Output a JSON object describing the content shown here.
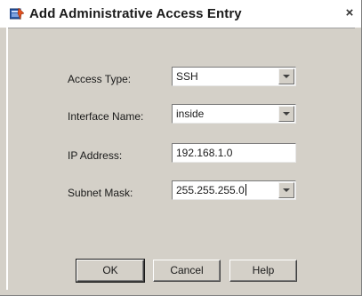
{
  "dialog": {
    "title": "Add Administrative Access Entry",
    "close_glyph": "×",
    "icon": "admin-entry-icon"
  },
  "form": {
    "access_type": {
      "label": "Access Type:",
      "value": "SSH"
    },
    "interface_name": {
      "label": "Interface Name:",
      "value": "inside"
    },
    "ip_address": {
      "label": "IP Address:",
      "value": "192.168.1.0"
    },
    "subnet_mask": {
      "label": "Subnet Mask:",
      "value": "255.255.255.0"
    }
  },
  "buttons": {
    "ok": "OK",
    "cancel": "Cancel",
    "help": "Help"
  }
}
